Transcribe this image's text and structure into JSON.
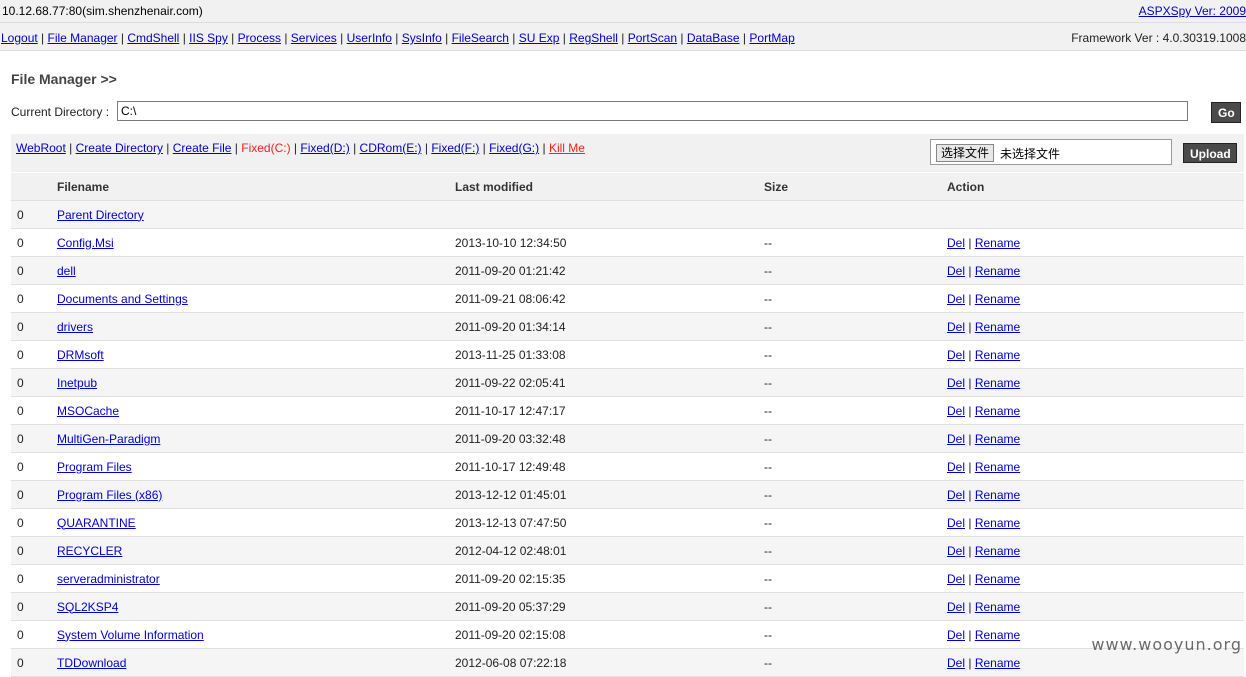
{
  "header": {
    "host": "10.12.68.77:80(sim.shenzhenair.com)",
    "version_link": "ASPXSpy Ver: 2009"
  },
  "nav": {
    "links": [
      "Logout",
      "File Manager",
      "CmdShell",
      "IIS Spy",
      "Process",
      "Services",
      "UserInfo",
      "SysInfo",
      "FileSearch",
      "SU Exp",
      "RegShell",
      "PortScan",
      "DataBase",
      "PortMap"
    ],
    "framework": "Framework Ver : 4.0.30319.1008"
  },
  "page": {
    "title": "File Manager >>",
    "current_dir_label": "Current Directory :",
    "current_dir_value": "C:\\",
    "go_label": "Go"
  },
  "toolbar": {
    "webroot": "WebRoot",
    "create_directory": "Create Directory",
    "create_file": "Create File",
    "drives": [
      {
        "label": "Fixed(C:)",
        "current": true
      },
      {
        "label": "Fixed(D:)",
        "current": false
      },
      {
        "label": "CDRom(E:)",
        "current": false
      },
      {
        "label": "Fixed(F:)",
        "current": false
      },
      {
        "label": "Fixed(G:)",
        "current": false
      }
    ],
    "kill_me": "Kill Me",
    "choose_file_label": "选择文件",
    "no_file_label": "未选择文件",
    "upload_label": "Upload"
  },
  "table": {
    "headers": [
      "Filename",
      "Last modified",
      "Size",
      "Action"
    ],
    "action_del": "Del",
    "action_rename": "Rename",
    "rows": [
      {
        "index": "0",
        "name": "Parent Directory",
        "modified": "",
        "size": "",
        "actions": false
      },
      {
        "index": "0",
        "name": "Config.Msi",
        "modified": "2013-10-10 12:34:50",
        "size": "--",
        "actions": true
      },
      {
        "index": "0",
        "name": "dell",
        "modified": "2011-09-20 01:21:42",
        "size": "--",
        "actions": true
      },
      {
        "index": "0",
        "name": "Documents and Settings",
        "modified": "2011-09-21 08:06:42",
        "size": "--",
        "actions": true
      },
      {
        "index": "0",
        "name": "drivers",
        "modified": "2011-09-20 01:34:14",
        "size": "--",
        "actions": true
      },
      {
        "index": "0",
        "name": "DRMsoft",
        "modified": "2013-11-25 01:33:08",
        "size": "--",
        "actions": true
      },
      {
        "index": "0",
        "name": "Inetpub",
        "modified": "2011-09-22 02:05:41",
        "size": "--",
        "actions": true
      },
      {
        "index": "0",
        "name": "MSOCache",
        "modified": "2011-10-17 12:47:17",
        "size": "--",
        "actions": true
      },
      {
        "index": "0",
        "name": "MultiGen-Paradigm",
        "modified": "2011-09-20 03:32:48",
        "size": "--",
        "actions": true
      },
      {
        "index": "0",
        "name": "Program Files",
        "modified": "2011-10-17 12:49:48",
        "size": "--",
        "actions": true
      },
      {
        "index": "0",
        "name": "Program Files (x86)",
        "modified": "2013-12-12 01:45:01",
        "size": "--",
        "actions": true
      },
      {
        "index": "0",
        "name": "QUARANTINE",
        "modified": "2013-12-13 07:47:50",
        "size": "--",
        "actions": true
      },
      {
        "index": "0",
        "name": "RECYCLER",
        "modified": "2012-04-12 02:48:01",
        "size": "--",
        "actions": true
      },
      {
        "index": "0",
        "name": "serveradministrator",
        "modified": "2011-09-20 02:15:35",
        "size": "--",
        "actions": true
      },
      {
        "index": "0",
        "name": "SQL2KSP4",
        "modified": "2011-09-20 05:37:29",
        "size": "--",
        "actions": true
      },
      {
        "index": "0",
        "name": "System Volume Information",
        "modified": "2011-09-20 02:15:08",
        "size": "--",
        "actions": true
      },
      {
        "index": "0",
        "name": "TDDownload",
        "modified": "2012-06-08 07:22:18",
        "size": "--",
        "actions": true
      }
    ]
  },
  "watermark": "www.wooyun.org"
}
